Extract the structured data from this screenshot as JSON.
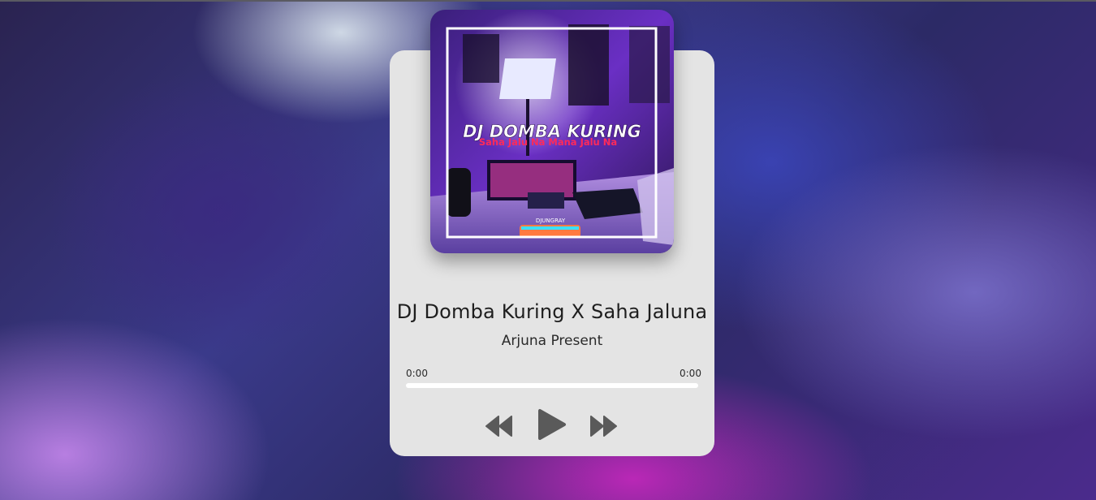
{
  "player": {
    "song_title": "DJ Domba Kuring X Saha Jaluna",
    "artist": "Arjuna Present",
    "current_time": "0:00",
    "total_time": "0:00",
    "progress": 0
  },
  "cover_art": {
    "headline": "DJ DOMBA KURING",
    "subline": "Saha Jalu Na Mana Jalu Na",
    "logo_text": "DJUNGRAY"
  },
  "controls": {
    "previous_icon": "rewind-icon",
    "play_icon": "play-icon",
    "next_icon": "fast-forward-icon"
  },
  "colors": {
    "card_background": "#e4e4e4",
    "control_icon": "#5a5a5a",
    "progress_track": "#ffffff"
  }
}
